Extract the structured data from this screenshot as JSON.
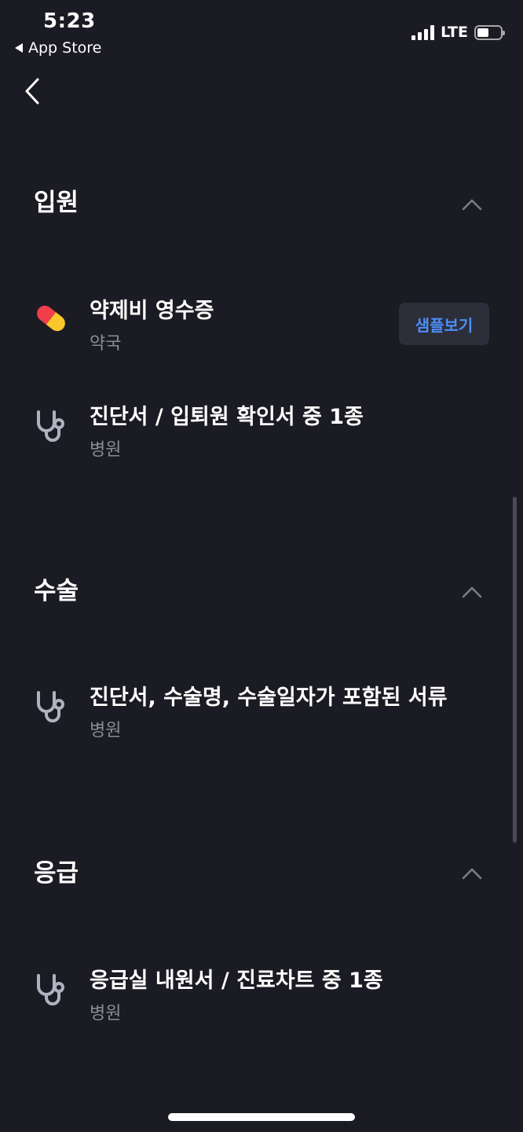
{
  "status": {
    "time": "5:23",
    "back_app": "App Store",
    "network": "LTE",
    "battery_level": 0.5
  },
  "sections": [
    {
      "title": "입원",
      "items": [
        {
          "title": "약제비 영수증",
          "subtitle": "약국",
          "icon": "pill-icon",
          "button": "샘플보기"
        },
        {
          "title": "진단서 / 입퇴원 확인서 중 1종",
          "subtitle": "병원",
          "icon": "stethoscope-icon"
        }
      ]
    },
    {
      "title": "수술",
      "items": [
        {
          "title": "진단서, 수술명, 수술일자가 포함된 서류",
          "subtitle": "병원",
          "icon": "stethoscope-icon"
        }
      ]
    },
    {
      "title": "응급",
      "items": [
        {
          "title": "응급실 내원서 / 진료차트 중 1종",
          "subtitle": "병원",
          "icon": "stethoscope-icon"
        }
      ]
    }
  ],
  "colors": {
    "background": "#1b1b23",
    "accent": "#4d8ef7",
    "subtext": "#8a8b94",
    "pill_red": "#f03e4a",
    "pill_yellow": "#fcc72c"
  }
}
